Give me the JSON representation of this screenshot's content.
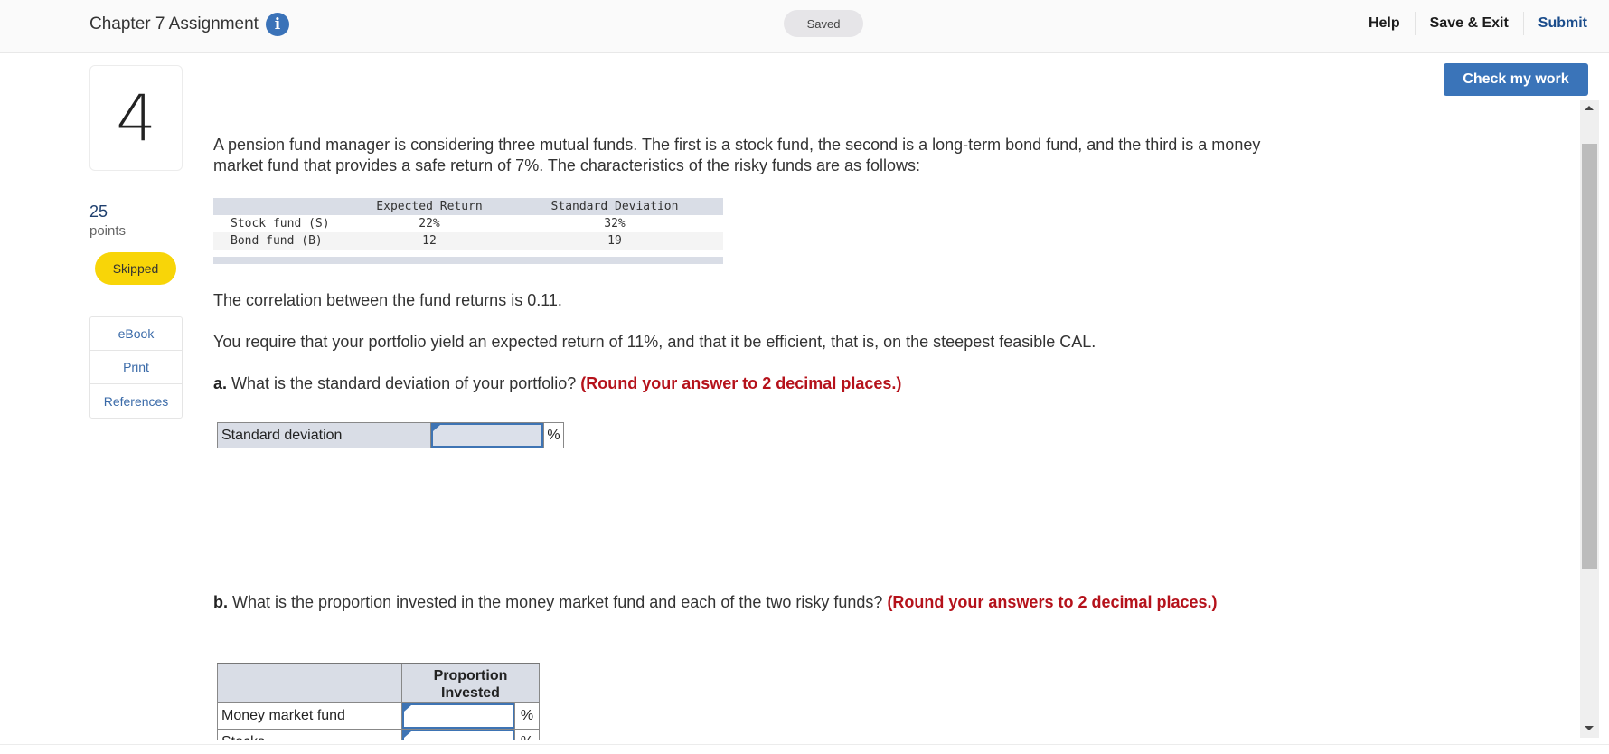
{
  "header": {
    "assignment_title": "Chapter 7 Assignment",
    "info_icon": "info-icon",
    "save_status": "Saved",
    "nav": {
      "help": "Help",
      "save_exit": "Save & Exit",
      "submit": "Submit"
    },
    "check_my_work": "Check my work"
  },
  "sidebar": {
    "question_number": "4",
    "points_value": "25",
    "points_label": "points",
    "status_badge": "Skipped",
    "links": [
      {
        "label": "eBook"
      },
      {
        "label": "Print"
      },
      {
        "label": "References"
      }
    ]
  },
  "question": {
    "intro": "A pension fund manager is considering three mutual funds. The first is a stock fund, the second is a long-term bond fund, and the third is a money market fund that provides a safe return of 7%. The characteristics of the risky funds are as follows:",
    "fund_table": {
      "headers": [
        "",
        "Expected Return",
        "Standard Deviation"
      ],
      "rows": [
        {
          "name": "Stock fund (S)",
          "expected_return": "22%",
          "std_dev": "32%"
        },
        {
          "name": "Bond fund (B)",
          "expected_return": "12",
          "std_dev": "19"
        }
      ]
    },
    "correlation": "The correlation between the fund returns is 0.11.",
    "requirement": "You require that your portfolio yield an expected return of 11%, and that it be efficient, that is, on the steepest feasible CAL.",
    "part_a": {
      "label": "a.",
      "text": "What is the standard deviation of your portfolio?",
      "instruction": "(Round your answer to 2 decimal places.)",
      "answer_table": {
        "row_label": "Standard deviation",
        "value": "",
        "unit": "%"
      }
    },
    "part_b": {
      "label": "b.",
      "text": "What is the proportion invested in the money market fund and each of the two risky funds?",
      "instruction": "(Round your answers to 2 decimal places.)",
      "answer_table": {
        "header": "Proportion Invested",
        "rows": [
          {
            "label": "Money market fund",
            "value": "",
            "unit": "%"
          },
          {
            "label": "Stocks",
            "value": "",
            "unit": "%"
          }
        ]
      }
    }
  }
}
